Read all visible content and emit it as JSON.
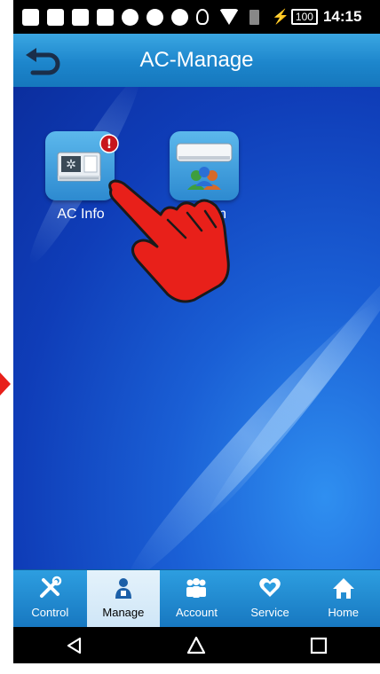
{
  "status_bar": {
    "battery": "100",
    "time": "14:15"
  },
  "title_bar": {
    "title": "AC-Manage"
  },
  "apps": [
    {
      "label": "AC Info",
      "icon": "ac-info-icon",
      "badge": "!"
    },
    {
      "label": "Assign",
      "icon": "ac-assign-icon"
    }
  ],
  "tabs": [
    {
      "label": "Control",
      "icon": "tools-icon",
      "active": false
    },
    {
      "label": "Manage",
      "icon": "manage-person-icon",
      "active": true
    },
    {
      "label": "Account",
      "icon": "group-icon",
      "active": false
    },
    {
      "label": "Service",
      "icon": "heart-hand-icon",
      "active": false
    },
    {
      "label": "Home",
      "icon": "home-icon",
      "active": false
    }
  ],
  "nav": {
    "back": "back-triangle-icon",
    "home": "home-circle-icon",
    "recent": "recent-square-icon"
  },
  "colors": {
    "title_bar": "#1d86cc",
    "tab_bar": "#1f87cc",
    "tab_active": "#d9ecf9",
    "pointer_hand": "#e8201a"
  }
}
